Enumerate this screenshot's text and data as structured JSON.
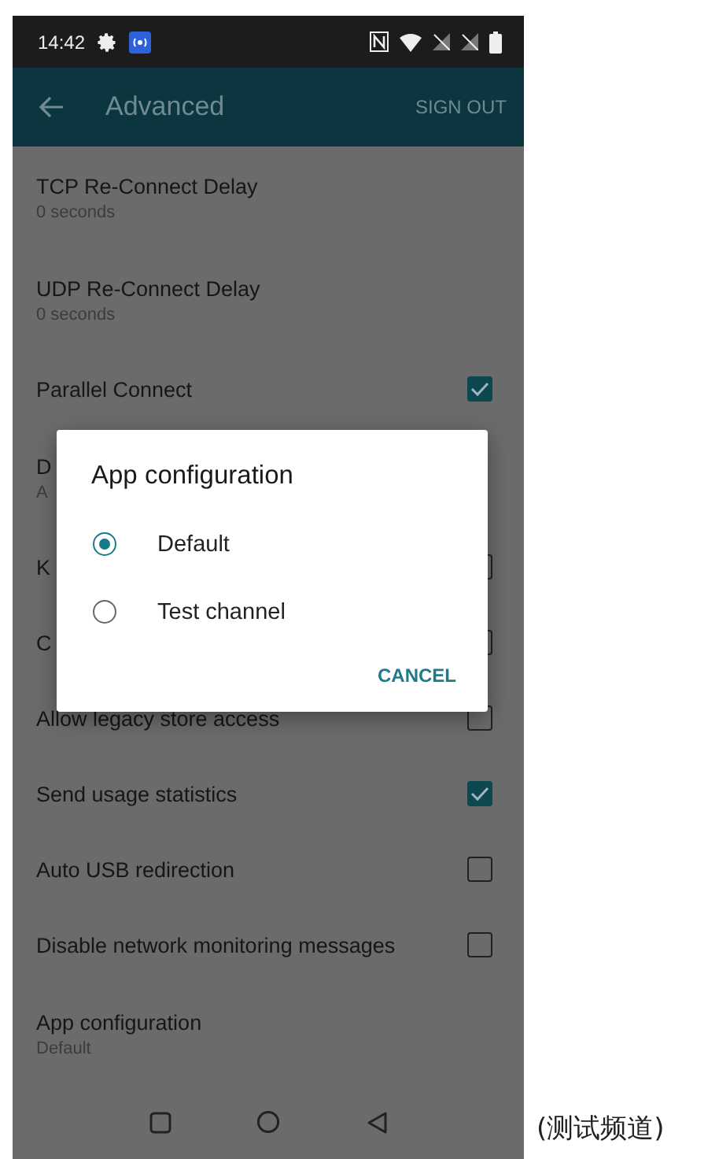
{
  "status_bar": {
    "time": "14:42"
  },
  "app_bar": {
    "title": "Advanced",
    "action": "SIGN OUT"
  },
  "settings": [
    {
      "kind": "text",
      "title": "TCP Re-Connect Delay",
      "summary": "0 seconds"
    },
    {
      "kind": "text",
      "title": "UDP Re-Connect Delay",
      "summary": "0 seconds"
    },
    {
      "kind": "checkbox",
      "title": "Parallel Connect",
      "checked": true
    },
    {
      "kind": "text",
      "title": "D",
      "summary": "A"
    },
    {
      "kind": "checkbox",
      "title": "K",
      "checked": false
    },
    {
      "kind": "checkbox",
      "title": "C",
      "checked": false
    },
    {
      "kind": "checkbox",
      "title": "Allow legacy store access",
      "checked": false
    },
    {
      "kind": "checkbox",
      "title": "Send usage statistics",
      "checked": true
    },
    {
      "kind": "checkbox",
      "title": "Auto USB redirection",
      "checked": false
    },
    {
      "kind": "checkbox",
      "title": "Disable network monitoring messages",
      "checked": false
    },
    {
      "kind": "text",
      "title": "App configuration",
      "summary": "Default"
    }
  ],
  "dialog": {
    "title": "App configuration",
    "options": [
      {
        "label": "Default",
        "selected": true
      },
      {
        "label": "Test channel",
        "selected": false
      }
    ],
    "button": "CANCEL"
  },
  "caption": "(测试频道)"
}
